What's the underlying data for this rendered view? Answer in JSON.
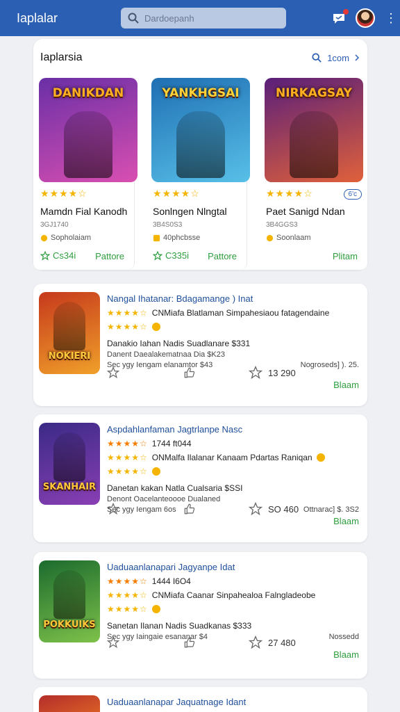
{
  "header": {
    "app_title": "Iaplalar",
    "search_placeholder": "Dardoepanh"
  },
  "featured": {
    "title": "Iaplarsia",
    "see_all": "1com",
    "items": [
      {
        "art_title": "DANIKDAN",
        "art_colors": [
          "#6a2fa6",
          "#d94fb1"
        ],
        "title_color": "#ffb020",
        "rating": "★★★★☆",
        "name": "Mamdn Fial Kanodh",
        "meta": "3GJ1740",
        "developer": "Sopholaiam",
        "price": "Cs34i",
        "action": "Pattore"
      },
      {
        "art_title": "YANKHGSAI",
        "art_colors": [
          "#1f6fb3",
          "#58c0e8"
        ],
        "title_color": "#ffd23a",
        "rating": "★★★★☆",
        "name": "Sonlngen Nlngtal",
        "meta": "3B4S0S3",
        "developer": "40phcbsse",
        "price": "C335i",
        "action": "Pattore"
      },
      {
        "art_title": "NIRKAGSAY",
        "art_colors": [
          "#5a1f7a",
          "#e0613a"
        ],
        "title_color": "#ffb020",
        "rating": "★★★★☆",
        "badge": "6'c",
        "name": "Paet Sanigd Ndan",
        "meta": "3B4GGS3",
        "developer": "Soonlaam",
        "price": "",
        "action": "Plitam"
      }
    ]
  },
  "list": [
    {
      "art_title": "NOKIERI",
      "art_colors": [
        "#c6391c",
        "#f0a02a"
      ],
      "title": "Nangal Ihatanar:",
      "title_extra": "Bdagamange ) Inat",
      "rating_a": "★★★★☆",
      "rating_a_text": "CNMiafa Blatlaman Simpahesiaou fatagendaine",
      "rating_b": "★★★★☆",
      "description": "Danakio Iahan Nadis Suadlanare $331",
      "detail_left": "Danent Daealakematnaa Dia $K23",
      "detail_mid": "Sec ygy Iengam elanamtor $43",
      "detail_right": "Nogroseds] ). 25.",
      "count": "13 290",
      "action": "Blaam"
    },
    {
      "art_title": "SKANHAIR",
      "art_colors": [
        "#3a2a86",
        "#8a3fb4"
      ],
      "title": "Aspdahlanfaman",
      "title_extra": "Jagtrlanpe Nasc",
      "rating_a": "★★★★☆",
      "rating_a_text": "1744 ft044",
      "rating_b": "★★★★☆",
      "rating_b_text": "ONMalfa Ilalanar Kanaam Pdartas Raniqan",
      "rating_c": "★★★★☆",
      "description": "Danetan kakan Natla Cualsaria $SSI",
      "detail_left": "Denont Oacelanteoooe Dualaned",
      "detail_mid": "Sec ygy Iengam 6os",
      "detail_right": "Ottnarac] $. 3S2",
      "count": "SO 460",
      "action": "Blaam"
    },
    {
      "art_title": "POKKUIKS",
      "art_colors": [
        "#1c6b2e",
        "#7ec24a"
      ],
      "title": "Uaduaanlanapari",
      "title_extra": "Jagyanpe Idat",
      "rating_a": "★★★★☆",
      "rating_a_text": "1444 I6O4",
      "rating_b": "★★★★☆",
      "rating_b_text": "CNMiafa Caanar Sinpahealoa Falngladeobe",
      "rating_c": "★★★★☆",
      "description": "Sanetan Ilanan Nadis Suadkanas $333",
      "detail_left": "Sec ygy Iaingaie esananar $4",
      "detail_mid": "",
      "detail_right": "Nossedd",
      "count": "27 480",
      "action": "Blaam"
    },
    {
      "art_title": "",
      "art_colors": [
        "#b32d2a",
        "#f07c24"
      ],
      "title": "Uaduaanlanapar",
      "title_extra": "Jaquatnage Idant",
      "rating_a": "★★★★☆"
    }
  ]
}
